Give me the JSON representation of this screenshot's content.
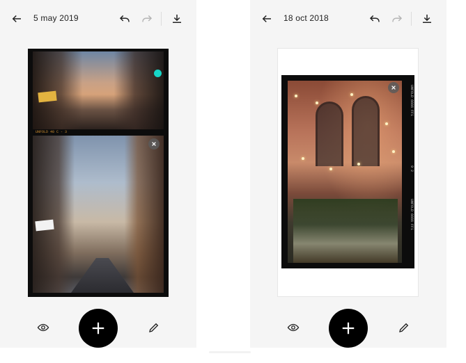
{
  "screens": [
    {
      "date": "5 may 2019",
      "frames": [
        {
          "strip_text": "UNFOLD  40 C - 3",
          "sign": "",
          "close_icon": "close-icon"
        },
        {
          "strip_text": "",
          "sign": "",
          "close_icon": "close-icon"
        }
      ]
    },
    {
      "date": "18 oct 2018",
      "side_text_top": "UNFOLD 6666 FF1",
      "side_text_mid": "9 2",
      "side_text_bottom": "UNFOLD 6666 FF1"
    }
  ],
  "icons": {
    "back": "arrow-left-icon",
    "undo": "undo-icon",
    "redo": "redo-icon",
    "download": "download-icon",
    "preview": "eye-icon",
    "add": "plus-icon",
    "edit": "pencil-icon"
  },
  "colors": {
    "accent_dot": "#16d6c7",
    "fab": "#000000",
    "film_text": "#c98a2d"
  }
}
